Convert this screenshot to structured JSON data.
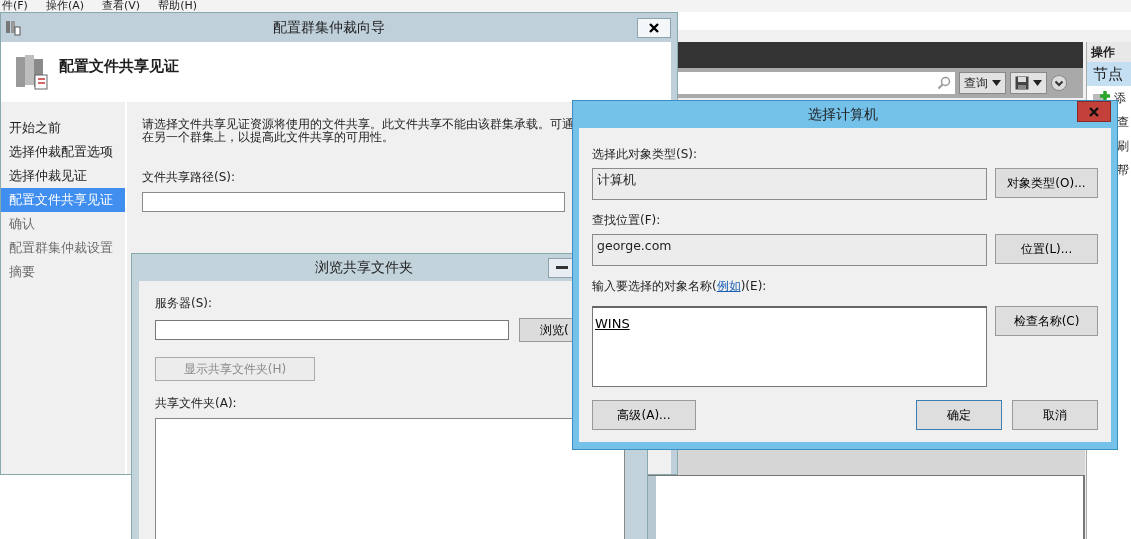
{
  "menu_bar": [
    "件(F)",
    "操作(A)",
    "查看(V)",
    "帮助(H)"
  ],
  "console": {
    "query_button": "查询",
    "actions_panel": {
      "header": "操作",
      "section": "节点",
      "items": [
        {
          "label": "添",
          "kind": "add"
        },
        {
          "label": "查",
          "kind": "plain"
        },
        {
          "label": "刷",
          "kind": "plain"
        },
        {
          "label": "帮",
          "kind": "plain"
        }
      ]
    }
  },
  "wizard": {
    "title": "配置群集仲裁向导",
    "page_title": "配置文件共享见证",
    "steps": [
      {
        "label": "开始之前",
        "selected": false,
        "disabled": false
      },
      {
        "label": "选择仲裁配置选项",
        "selected": false,
        "disabled": false
      },
      {
        "label": "选择仲裁见证",
        "selected": false,
        "disabled": false
      },
      {
        "label": "配置文件共享见证",
        "selected": true,
        "disabled": false
      },
      {
        "label": "确认",
        "selected": false,
        "disabled": true
      },
      {
        "label": "配置群集仲裁设置",
        "selected": false,
        "disabled": true
      },
      {
        "label": "摘要",
        "selected": false,
        "disabled": true
      }
    ],
    "description": [
      "请选择文件共享见证资源将使用的文件共享。此文件共享不能由该群集承载。可通",
      "在另一个群集上，以提高此文件共享的可用性。"
    ],
    "path_label": "文件共享路径(S):"
  },
  "browse_dialog": {
    "title": "浏览共享文件夹",
    "server_label": "服务器(S):",
    "browse_button": "浏览(",
    "show_button": {
      "label": "显示共享文件夹(H)",
      "disabled": true
    },
    "folders_label": "共享文件夹(A):"
  },
  "select_computer": {
    "title": "选择计算机",
    "type_label": "选择此对象类型(S):",
    "type_value": "计算机",
    "type_button": "对象类型(O)...",
    "location_label": "查找位置(F):",
    "location_value": "george.com",
    "location_button": "位置(L)...",
    "name_label": {
      "before": "输入要选择的对象名称(",
      "link": "例如",
      "after": ")(E):"
    },
    "name_value": "WINS",
    "resolved": true,
    "check_button": "检查名称(C)",
    "buttons": [
      {
        "label": "高级(A)...",
        "default": false
      },
      {
        "label": "确定",
        "default": true
      },
      {
        "label": "取消",
        "default": false
      }
    ]
  }
}
